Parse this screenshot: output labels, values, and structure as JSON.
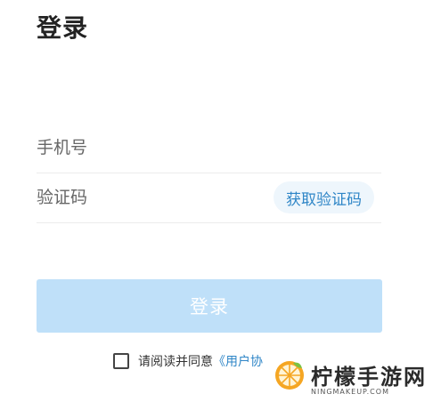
{
  "header": {
    "title": "登录"
  },
  "form": {
    "phone_placeholder": "手机号",
    "code_placeholder": "验证码",
    "get_code_label": "获取验证码",
    "login_label": "登录"
  },
  "agreement": {
    "prefix": "请阅读并同意",
    "link_text": "《用户协"
  },
  "watermark": {
    "brand": "柠檬手游网",
    "site": "NINGMAKEUP.COM"
  },
  "colors": {
    "accent": "#2f86c7",
    "button_disabled": "#bfe0f9",
    "code_button_bg": "#eef6fc"
  }
}
